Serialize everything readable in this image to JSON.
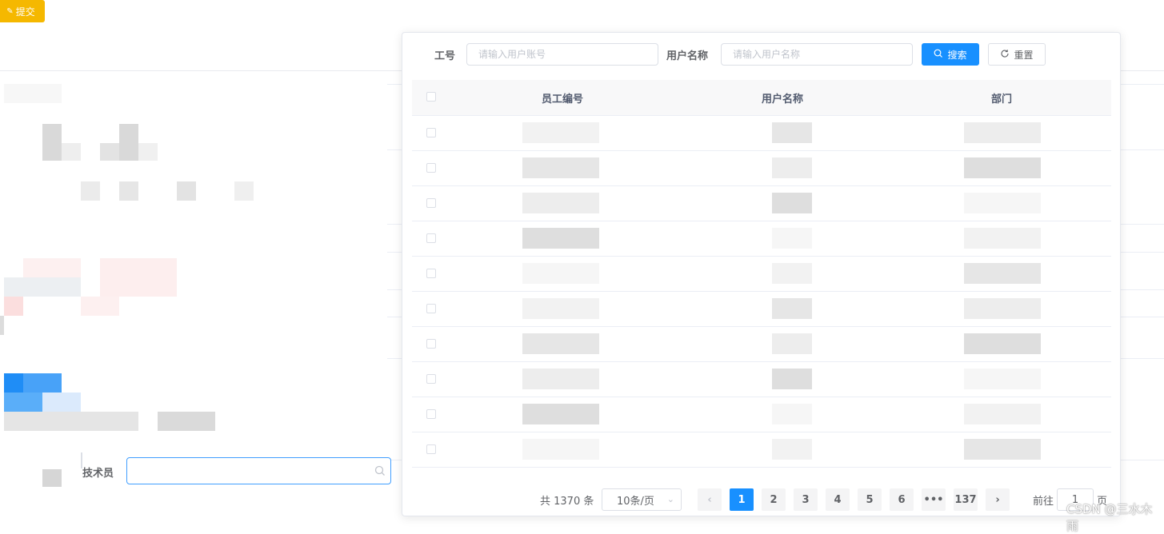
{
  "toolbar": {
    "submit_label": "提交"
  },
  "background_form": {
    "technician_label": "技术员"
  },
  "search": {
    "employee_id_label": "工号",
    "employee_id_placeholder": "请输入用户账号",
    "username_label": "用户名称",
    "username_placeholder": "请输入用户名称",
    "search_button": "搜索",
    "reset_button": "重置"
  },
  "table": {
    "columns": [
      "员工编号",
      "用户名称",
      "部门"
    ],
    "row_count_visible": 10
  },
  "pagination": {
    "total_text": "共 1370 条",
    "page_size": "10条/页",
    "pages": [
      "1",
      "2",
      "3",
      "4",
      "5",
      "6",
      "•••",
      "137"
    ],
    "current_page": "1",
    "goto_prefix": "前往",
    "goto_value": "1",
    "goto_suffix": "页"
  },
  "watermark": "CSDN @三水木雨",
  "colors": {
    "primary": "#1890ff",
    "warning": "#f5b800"
  },
  "icons": {
    "search": "search-icon",
    "reset": "refresh-icon",
    "prev": "chevron-left-icon",
    "next": "chevron-right-icon",
    "dropdown": "chevron-down-icon"
  }
}
